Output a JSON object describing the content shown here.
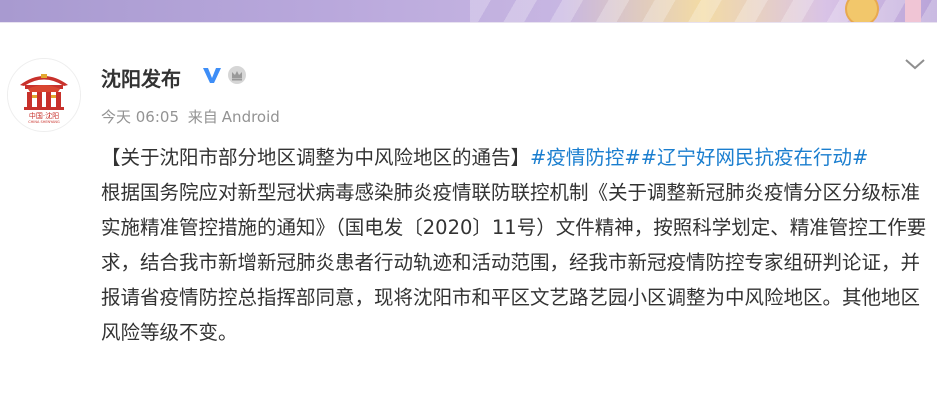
{
  "post": {
    "author": "沈阳发布",
    "verified_icon": "verified-v-icon",
    "member_icon": "crown-badge-icon",
    "time": "今天 06:05",
    "source_prefix": "来自",
    "source": "Android",
    "headline": "【关于沈阳市部分地区调整为中风险地区的通告】",
    "topics": [
      "#疫情防控#",
      "#辽宁好网民抗疫在行动#"
    ],
    "body": "根据国务院应对新型冠状病毒感染肺炎疫情联防联控机制《关于调整新冠肺炎疫情分区分级标准实施精准管控措施的通知》（国电发〔2020〕11号）文件精神，按照科学划定、精准管控工作要求，结合我市新增新冠肺炎患者行动轨迹和活动范围，经我市新冠疫情防控专家组研判论证，并报请省疫情防控总指挥部同意，现将沈阳市和平区文艺路艺园小区调整为中风险地区。其他地区风险等级不变。"
  },
  "avatar": {
    "text": "中国·沈阳",
    "subtext": "CHINA SHENYANG"
  },
  "colors": {
    "topic": "#1a7ecf",
    "verified": "#3e8ef7",
    "meta": "#939393"
  }
}
